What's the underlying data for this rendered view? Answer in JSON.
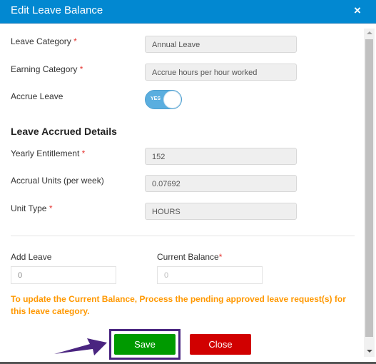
{
  "header": {
    "title": "Edit Leave Balance",
    "close_symbol": "×"
  },
  "form": {
    "leave_category": {
      "label": "Leave Category",
      "required": "*",
      "value": "Annual Leave"
    },
    "earning_category": {
      "label": "Earning Category",
      "required": "*",
      "value": "Accrue hours per hour worked"
    },
    "accrue_leave": {
      "label": "Accrue Leave",
      "toggle_text": "YES",
      "on": true
    }
  },
  "details": {
    "section_title": "Leave Accrued Details",
    "yearly_entitlement": {
      "label": "Yearly Entitlement",
      "required": "*",
      "value": "152"
    },
    "accrual_units": {
      "label": "Accrual Units (per week)",
      "value": "0.07692"
    },
    "unit_type": {
      "label": "Unit Type",
      "required": "*",
      "value": "HOURS"
    }
  },
  "balance": {
    "add_leave": {
      "label": "Add Leave",
      "placeholder": "0"
    },
    "current_balance": {
      "label": "Current Balance",
      "required": "*",
      "placeholder": "0"
    },
    "notice": "To update the Current Balance, Process the pending approved leave request(s) for this leave category."
  },
  "buttons": {
    "save": "Save",
    "close": "Close"
  },
  "colors": {
    "header": "#0288d1",
    "save": "#009a00",
    "close": "#d10000",
    "notice": "#ff9800",
    "highlight": "#4a2580"
  }
}
